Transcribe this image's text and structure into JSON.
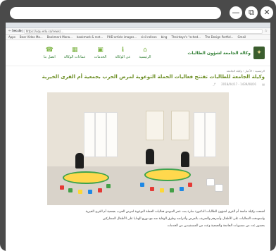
{
  "window": {
    "controls": {
      "minimize": "—",
      "restore": "⧉",
      "close": "✕"
    }
  },
  "browser": {
    "tab_label": "Secure | https://uqu.edu.sa",
    "address_url": "https://uqu.edu.sa/news/...",
    "bookmarks": [
      "Apps",
      "Bear Video Ma...",
      "Bookmark Mana...",
      "bookmark & rest...",
      "PHD article images...",
      "civil rollcon",
      "bing",
      "Theirdays's \"sched...",
      "The Design Portfol...",
      "Gmail"
    ]
  },
  "site": {
    "brand_name": "وكالة الجامعة لشؤون الطالبات",
    "menu": [
      {
        "label": "الرئيسية",
        "icon": "home-icon"
      },
      {
        "label": "عن الوكالة",
        "icon": "info-icon"
      },
      {
        "label": "الخدمات",
        "icon": "services-icon"
      },
      {
        "label": "عمادات الوكالة",
        "icon": "building-icon"
      },
      {
        "label": "اتصل بنا",
        "icon": "phone-icon"
      }
    ]
  },
  "article": {
    "breadcrumb": "الرئيسية › الأخبار › وكيلة الجامعة",
    "title": "وكيلة الجامعة للطالبات تفتتح فعاليات الحملة التوعوية لمرض الحرب بجمعية أم القرى الخيرية",
    "date": "2018/04/17 - 1439/08/01",
    "paragraphs": [
      "افتتحت وكيلة جامعة أم القرى لشؤون الطالبات الدكتورة سارة بنت عمر العبودي فعاليات الحملة التوعوية لمرض الحرب بجمعية أم القرى الخيرية",
      "واستهدفت الفعاليات على الأطفال وأسرهم والتعريف بالمرض وأعراضه وطرق الوقاية منه مع توزيع الهدايا على الأطفال المشاركين",
      "بحضور عدد من منسوبات الجامعة والجمعية وعدد من المستفيدين من الخدمات"
    ]
  }
}
